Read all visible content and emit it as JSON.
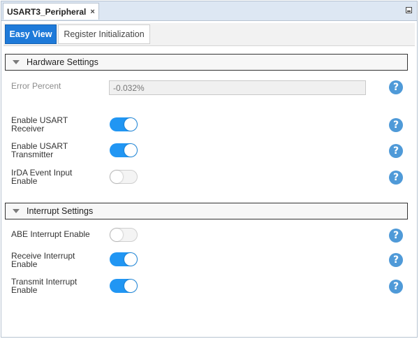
{
  "document_tab": {
    "title": "USART3_Peripheral",
    "close_glyph": "×"
  },
  "view_tabs": {
    "active": "Easy View",
    "inactive": "Register Initialization"
  },
  "hardware": {
    "header": "Hardware Settings",
    "error_percent": {
      "label": "Error Percent",
      "value": "-0.032%"
    },
    "rows": [
      {
        "label_line1": "Enable USART",
        "label_line2": "Receiver",
        "state": "on"
      },
      {
        "label_line1": "Enable USART",
        "label_line2": "Transmitter",
        "state": "on"
      },
      {
        "label_line1": "IrDA Event Input",
        "label_line2": "Enable",
        "state": "off"
      }
    ]
  },
  "interrupt": {
    "header": "Interrupt Settings",
    "rows": [
      {
        "label_line1": "ABE Interrupt Enable",
        "label_line2": "",
        "state": "off"
      },
      {
        "label_line1": "Receive Interrupt",
        "label_line2": "Enable",
        "state": "on"
      },
      {
        "label_line1": "Transmit Interrupt",
        "label_line2": "Enable",
        "state": "on"
      }
    ]
  },
  "help_glyph": "?",
  "colors": {
    "accent": "#1e7ad9",
    "toggle_on": "#2196f3",
    "help": "#4f9ad8"
  }
}
